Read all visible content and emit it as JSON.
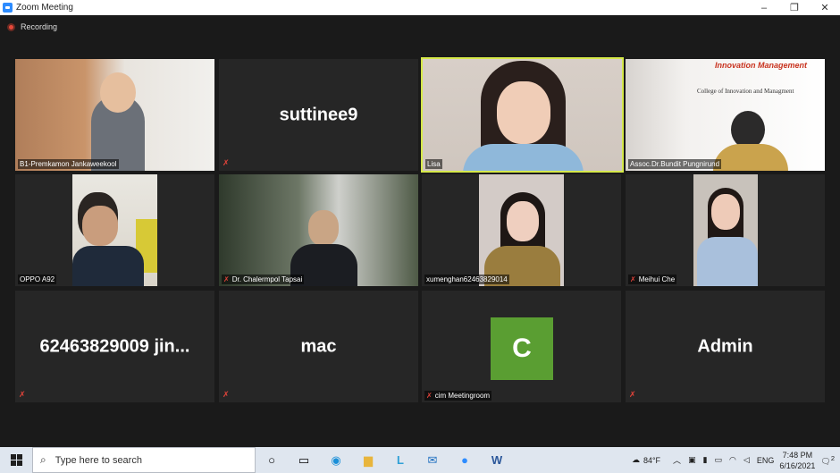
{
  "window": {
    "title": "Zoom Meeting",
    "minimize": "–",
    "restore": "❐",
    "close": "✕"
  },
  "recording": {
    "label": "Recording"
  },
  "tiles": [
    {
      "name": "B1-Premkamon Jankaweekool",
      "type": "video",
      "muted": false
    },
    {
      "name": "suttinee9",
      "type": "name",
      "muted": true
    },
    {
      "name": "Lisa",
      "type": "video",
      "muted": false,
      "active": true
    },
    {
      "name": "Assoc.Dr.Bundit Pungnirund",
      "type": "video",
      "muted": false,
      "banner_title": "Innovation Management",
      "banner_subtitle": "College of Innovation and Managment"
    },
    {
      "name": "OPPO A92",
      "type": "video",
      "muted": false
    },
    {
      "name": "Dr. Chalermpol Tapsai",
      "type": "video",
      "muted": true
    },
    {
      "name": "xumenghan62463829014",
      "type": "video",
      "muted": false
    },
    {
      "name": "Meihui Che",
      "type": "video",
      "muted": true
    },
    {
      "name": "62463829009  jin...",
      "type": "name",
      "muted": true
    },
    {
      "name": "mac",
      "type": "name",
      "muted": true
    },
    {
      "name": "cim Meetingroom",
      "type": "avatar",
      "avatar_letter": "C",
      "avatar_color": "#5a9e32",
      "muted": true
    },
    {
      "name": "Admin",
      "type": "name",
      "muted": true
    }
  ],
  "taskbar": {
    "search_placeholder": "Type here to search",
    "weather": "84°F",
    "language": "ENG",
    "time": "7:48 PM",
    "date": "6/16/2021",
    "notification_count": "2"
  },
  "colors": {
    "accent": "#2d8cff",
    "active_border": "#d6e94a",
    "mute": "#e0433a",
    "tile_bg": "#262626"
  }
}
